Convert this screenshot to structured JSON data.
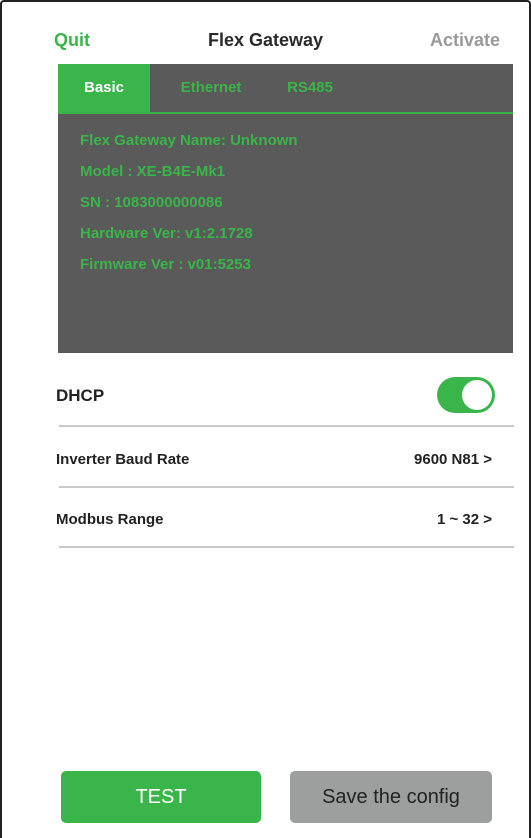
{
  "header": {
    "quit_label": "Quit",
    "title": "Flex Gateway",
    "activate_label": "Activate"
  },
  "tabs": [
    {
      "label": "Basic",
      "active": true
    },
    {
      "label": "Ethernet",
      "active": false
    },
    {
      "label": "RS485",
      "active": false
    }
  ],
  "info": {
    "name": "Flex Gateway Name: Unknown",
    "model": "Model : XE-B4E-Mk1",
    "sn": "SN : 1083000000086",
    "hardware": "Hardware Ver: v1:2.1728",
    "firmware": "Firmware Ver : v01:5253"
  },
  "settings": {
    "dhcp_label": "DHCP",
    "dhcp_enabled": true,
    "baud_label": "Inverter Baud Rate",
    "baud_value": "9600 N81  >",
    "modbus_label": "Modbus Range",
    "modbus_value": "1 ~ 32  >"
  },
  "buttons": {
    "test_label": "TEST",
    "save_label": "Save the config"
  },
  "colors": {
    "accent": "#3ab54a",
    "panel": "#595a59",
    "disabled": "#9a9a9a"
  }
}
